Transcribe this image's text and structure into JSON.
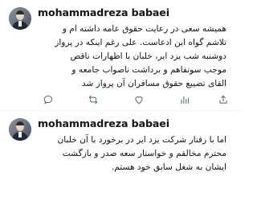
{
  "tweets": [
    {
      "username": "mohammadreza babaei",
      "lines": [
        "همیشه سعی در رعایت حقوق عامه داشته ام و",
        "تلاشم گواه این ادعاست. علی رغم اینکه در پرواز",
        "دوشنبه شب یزد ایر، خلبان با اظهارات ناقص",
        "موجب سوتفاهم و برداشت ناصواب جامعه و",
        "القای تضییع حقوق مسافران آن پرواز شد"
      ],
      "actions": [
        "reply-icon",
        "retweet-icon",
        "like-icon",
        "views-icon",
        "share-icon"
      ]
    },
    {
      "username": "mohammadreza babaei",
      "lines": [
        "اما با رفتار شرکت یزد ایر در برخورد با آن خلبان",
        "محترم مخالفم و خواستار سعه صدر و بازگشت",
        "ایشان به شغل سابق خود هستم."
      ]
    }
  ],
  "colors": {
    "text": "#0f1419",
    "icon": "#536471",
    "divider": "#eff3f4"
  }
}
